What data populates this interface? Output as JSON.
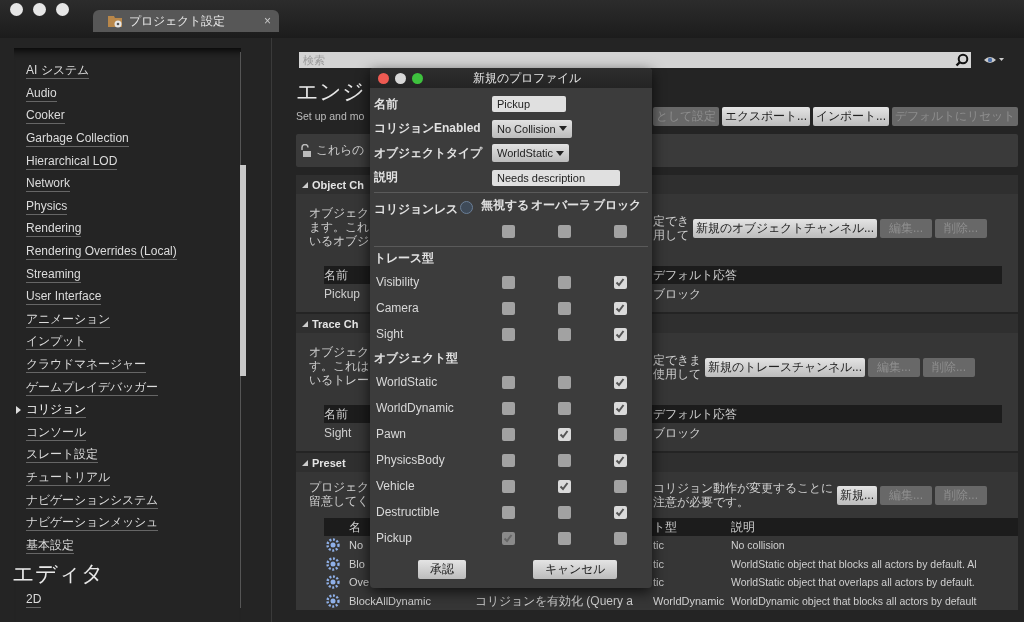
{
  "window": {
    "tab": "プロジェクト設定",
    "tab_close": "×"
  },
  "sidebar": {
    "items": [
      {
        "label": "AI システム",
        "selected": false
      },
      {
        "label": "Audio",
        "selected": false
      },
      {
        "label": "Cooker",
        "selected": false
      },
      {
        "label": "Garbage Collection",
        "selected": false
      },
      {
        "label": "Hierarchical LOD",
        "selected": false
      },
      {
        "label": "Network",
        "selected": false
      },
      {
        "label": "Physics",
        "selected": false
      },
      {
        "label": "Rendering",
        "selected": false
      },
      {
        "label": "Rendering Overrides (Local)",
        "selected": false
      },
      {
        "label": "Streaming",
        "selected": false
      },
      {
        "label": "User Interface",
        "selected": false
      },
      {
        "label": "アニメーション",
        "selected": false
      },
      {
        "label": "インプット",
        "selected": false
      },
      {
        "label": "クラウドマネージャー",
        "selected": false
      },
      {
        "label": "ゲームプレイデバッガー",
        "selected": false
      },
      {
        "label": "コリジョン",
        "selected": true
      },
      {
        "label": "コンソール",
        "selected": false
      },
      {
        "label": "スレート設定",
        "selected": false
      },
      {
        "label": "チュートリアル",
        "selected": false
      },
      {
        "label": "ナビゲーションシステム",
        "selected": false
      },
      {
        "label": "ナビゲーションメッシュ",
        "selected": false
      },
      {
        "label": "基本設定",
        "selected": false
      }
    ],
    "editor_heading": "エディタ",
    "editor_items": [
      {
        "label": "2D",
        "selected": false
      }
    ]
  },
  "search": {
    "placeholder": "検索"
  },
  "header": {
    "title": "エンジ",
    "subtitle": "Set up and mo",
    "buttons": [
      {
        "label": "として設定",
        "disabled": true
      },
      {
        "label": "エクスポート...",
        "disabled": false
      },
      {
        "label": "インポート...",
        "disabled": false
      },
      {
        "label": "デフォルトにリセット",
        "disabled": true
      }
    ]
  },
  "notice": "これらの",
  "sections": [
    {
      "kind": "channel",
      "title": "Object Ch",
      "expanded": true,
      "description_left": [
        "オブジェク",
        "ます。これ",
        "いるオブジ"
      ],
      "description_right": [
        "定でき",
        "用して"
      ],
      "buttons": [
        {
          "label": "新規のオブジェクトチャンネル...",
          "disabled": false
        },
        {
          "label": "編集...",
          "disabled": true
        },
        {
          "label": "削除...",
          "disabled": true
        }
      ],
      "table": {
        "columns_left": [
          "名前"
        ],
        "columns_right": [
          "デフォルト応答"
        ],
        "rows": [
          {
            "left": "Pickup",
            "right": "ブロック"
          }
        ]
      }
    },
    {
      "kind": "channel",
      "title": "Trace Ch",
      "expanded": true,
      "description_left": [
        "オブジェク",
        "す。これは",
        "いるトレー"
      ],
      "description_right": [
        "定できま",
        "使用して"
      ],
      "buttons": [
        {
          "label": "新規のトレースチャンネル...",
          "disabled": false
        },
        {
          "label": "編集...",
          "disabled": true
        },
        {
          "label": "削除...",
          "disabled": true
        }
      ],
      "table": {
        "columns_left": [
          "名前"
        ],
        "columns_right": [
          "デフォルト応答"
        ],
        "rows": [
          {
            "left": "Sight",
            "right": "ブロック"
          }
        ]
      }
    },
    {
      "kind": "preset",
      "title": "Preset",
      "expanded": true,
      "description_left": [
        "プロジェク",
        "留意してく"
      ],
      "description_right": [
        "コリジョン動作が変更することに",
        "注意が必要です。"
      ],
      "buttons": [
        {
          "label": "新規...",
          "disabled": false
        },
        {
          "label": "編集...",
          "disabled": true
        },
        {
          "label": "削除...",
          "disabled": true
        }
      ],
      "table": {
        "columns_left": [
          "名"
        ],
        "columns_right": [
          "ト型",
          "説明"
        ],
        "rows": [
          {
            "kind": "split",
            "name": "No",
            "type": "tic",
            "description": "No collision"
          },
          {
            "kind": "split",
            "name": "Blo",
            "type": "tic",
            "description": "WorldStatic object that blocks all actors by default. Al"
          },
          {
            "kind": "split",
            "name": "Ove",
            "type": "tic",
            "description": "WorldStatic object that overlaps all actors by default."
          },
          {
            "kind": "full",
            "name": "BlockAllDynamic",
            "collision": "コリジョンを有効化 (Query a",
            "type": "WorldDynamic",
            "description": "WorldDynamic object that blocks all actors by default"
          }
        ]
      }
    }
  ],
  "dialog": {
    "title": "新規のプロファイル",
    "fields": [
      {
        "kind": "text",
        "label": "名前",
        "value": "Pickup"
      },
      {
        "kind": "dropdown",
        "label": "コリジョンEnabled",
        "value": "No Collision"
      },
      {
        "kind": "dropdown",
        "label": "オブジェクトタイプ",
        "value": "WorldStatic"
      },
      {
        "kind": "text",
        "label": "説明",
        "value": "Needs description"
      }
    ],
    "response_label": "コリジョンレス",
    "response_columns": [
      "無視する",
      "オーバーラ",
      "ブロック"
    ],
    "response_all": [
      {
        "checked": false,
        "disabled": false
      },
      {
        "checked": false,
        "disabled": false
      },
      {
        "checked": false,
        "disabled": false
      }
    ],
    "groups": [
      {
        "title": "トレース型",
        "rows": [
          {
            "name": "Visibility",
            "checks": [
              {
                "checked": false,
                "disabled": false
              },
              {
                "checked": false,
                "disabled": false
              },
              {
                "checked": true,
                "disabled": false
              }
            ]
          },
          {
            "name": "Camera",
            "checks": [
              {
                "checked": false,
                "disabled": false
              },
              {
                "checked": false,
                "disabled": false
              },
              {
                "checked": true,
                "disabled": false
              }
            ]
          },
          {
            "name": "Sight",
            "checks": [
              {
                "checked": false,
                "disabled": false
              },
              {
                "checked": false,
                "disabled": false
              },
              {
                "checked": true,
                "disabled": false
              }
            ]
          }
        ]
      },
      {
        "title": "オブジェクト型",
        "rows": [
          {
            "name": "WorldStatic",
            "checks": [
              {
                "checked": false,
                "disabled": false
              },
              {
                "checked": false,
                "disabled": false
              },
              {
                "checked": true,
                "disabled": false
              }
            ]
          },
          {
            "name": "WorldDynamic",
            "checks": [
              {
                "checked": false,
                "disabled": false
              },
              {
                "checked": false,
                "disabled": false
              },
              {
                "checked": true,
                "disabled": false
              }
            ]
          },
          {
            "name": "Pawn",
            "checks": [
              {
                "checked": false,
                "disabled": false
              },
              {
                "checked": true,
                "disabled": false
              },
              {
                "checked": false,
                "disabled": false
              }
            ]
          },
          {
            "name": "PhysicsBody",
            "checks": [
              {
                "checked": false,
                "disabled": false
              },
              {
                "checked": false,
                "disabled": false
              },
              {
                "checked": true,
                "disabled": false
              }
            ]
          },
          {
            "name": "Vehicle",
            "checks": [
              {
                "checked": false,
                "disabled": false
              },
              {
                "checked": true,
                "disabled": false
              },
              {
                "checked": false,
                "disabled": false
              }
            ]
          },
          {
            "name": "Destructible",
            "checks": [
              {
                "checked": false,
                "disabled": false
              },
              {
                "checked": false,
                "disabled": false
              },
              {
                "checked": true,
                "disabled": false
              }
            ]
          },
          {
            "name": "Pickup",
            "checks": [
              {
                "checked": true,
                "disabled": true
              },
              {
                "checked": false,
                "disabled": false
              },
              {
                "checked": false,
                "disabled": false
              }
            ]
          }
        ]
      }
    ],
    "buttons": [
      "承認",
      "キャンセル"
    ]
  }
}
